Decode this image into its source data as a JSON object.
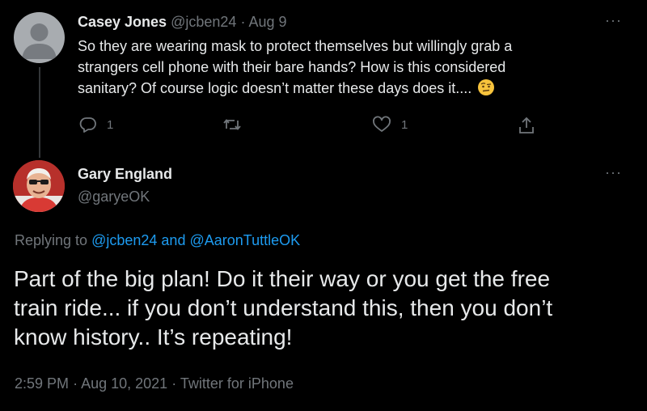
{
  "colors": {
    "background": "#000000",
    "text": "#e7e9ea",
    "muted": "#71767b",
    "link": "#1d9bf0"
  },
  "parent_tweet": {
    "author_name": "Casey Jones",
    "handle": "@jcben24",
    "separator": "·",
    "date": "Aug 9",
    "text_lines": [
      "So they are wearing mask to protect themselves but willingly grab a",
      "strangers cell phone with their bare hands?  How is this considered",
      "sanitary?  Of course logic doesn’t matter these days does it...."
    ],
    "emoji_icon": "face-with-raised-eyebrow-icon",
    "reply_count": "1",
    "retweet_count": "",
    "like_count": "1"
  },
  "main_tweet": {
    "author_name": "Gary England",
    "handle": "@garyeOK",
    "replying_prefix": "Replying to",
    "reply_to_1": "@jcben24",
    "reply_and": "and",
    "reply_to_2": "@AaronTuttleOK",
    "text_lines": [
      "Part of the big plan!  Do it their way or you get the free",
      "train ride... if you don’t understand this, then you don’t",
      "know history..  It’s  repeating!"
    ],
    "time": "2:59 PM",
    "sep1": "·",
    "date": "Aug 10, 2021",
    "sep2": "·",
    "source": "Twitter for iPhone"
  },
  "more_label": "···"
}
